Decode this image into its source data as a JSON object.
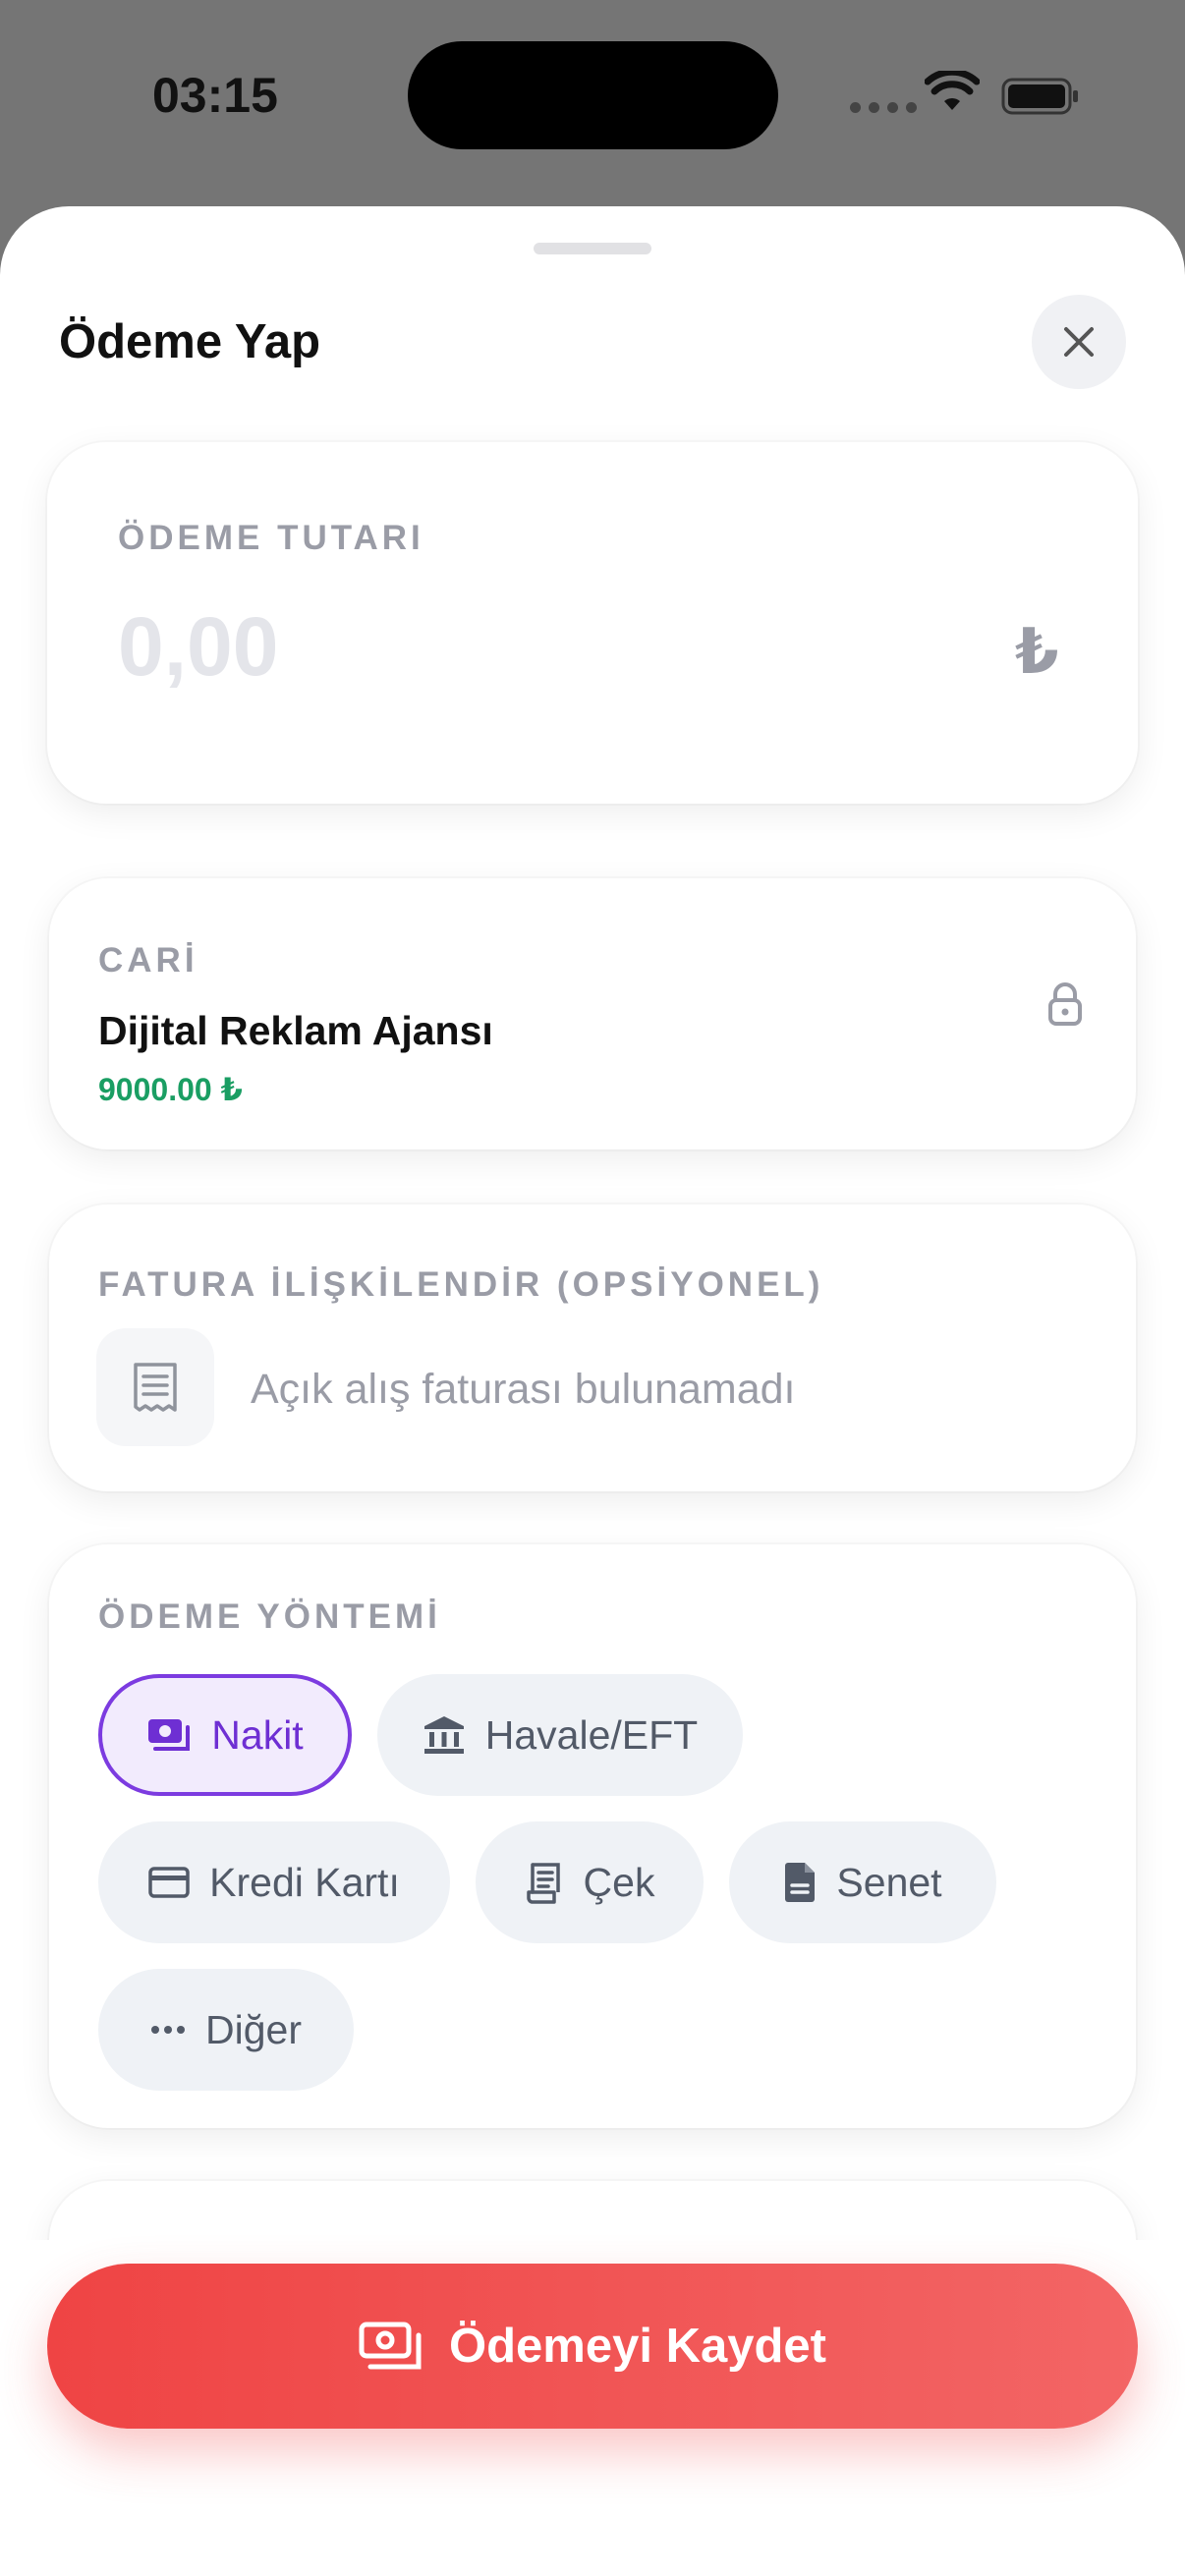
{
  "status_bar": {
    "time": "03:15"
  },
  "sheet": {
    "title": "Ödeme Yap",
    "amount": {
      "label": "ÖDEME TUTARI",
      "placeholder": "0,00",
      "currency_symbol": "₺"
    },
    "cari": {
      "label": "CARİ",
      "name": "Dijital Reklam Ajansı",
      "balance": "9000.00 ₺",
      "balance_color": "#1a9e63"
    },
    "fatura": {
      "label": "FATURA İLİŞKİLENDİR (OPSİYONEL)",
      "empty_text": "Açık alış faturası bulunamadı"
    },
    "payment_method": {
      "label": "ÖDEME YÖNTEMİ",
      "selected": "Nakit",
      "options": [
        {
          "label": "Nakit",
          "icon": "cash-icon"
        },
        {
          "label": "Havale/EFT",
          "icon": "bank-icon"
        },
        {
          "label": "Kredi Kartı",
          "icon": "credit-card-icon"
        },
        {
          "label": "Çek",
          "icon": "check-receipt-icon"
        },
        {
          "label": "Senet",
          "icon": "document-icon"
        },
        {
          "label": "Diğer",
          "icon": "more-dots-icon"
        }
      ]
    },
    "save_button": {
      "label": "Ödemeyi Kaydet",
      "icon": "cash-stack-icon"
    }
  },
  "colors": {
    "accent": "#7c3be0",
    "primary_button": "#ef4444",
    "positive": "#1a9e63"
  }
}
